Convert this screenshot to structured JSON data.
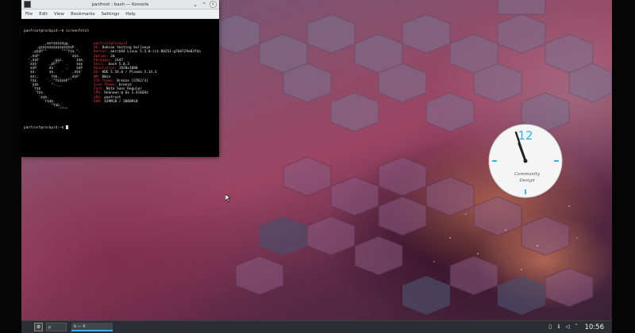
{
  "window": {
    "title": "panfrost : bash — Konsole",
    "menu": [
      "File",
      "Edit",
      "View",
      "Bookmarks",
      "Settings",
      "Help"
    ]
  },
  "terminal": {
    "command_line": "panfrost@rockpi4:~$ screenfetch",
    "logo_lines": [
      "         _,met$$$$$gg.",
      "      ,g$$$$$$$$$$$$$$$P.",
      "    ,g$$P\"\"       \"\"\"Y$$.\".",
      "   ,$$P'              `$$$.",
      "  ',$$P       ,ggs.     `$$b:",
      "  `d$$'     ,$P\"'   .    $$$",
      "   $$P      d$'     ,    $$P",
      "   $$:      $$.   -    ,d$$'",
      "   $$\\;      Y$b._   _,d$P'",
      "   Y$$.    `.`\"Y$$$$P\"'",
      "   `$$b      \"-.__",
      "    `Y$$",
      "     `Y$$.",
      "       `$$b.",
      "         `Y$$b.",
      "            `\"Y$b._",
      "                `\"\"\"\""
    ],
    "info": [
      {
        "k": "panfrost@rockpi4",
        "v": ""
      },
      {
        "k": "OS:",
        "v": " Debian testing bullseye"
      },
      {
        "k": "Kernel:",
        "v": " aarch64 Linux 5.3.0-rc1-00251-g7b0729e03f4a"
      },
      {
        "k": "Uptime:",
        "v": " 2m"
      },
      {
        "k": "Packages:",
        "v": " 1447"
      },
      {
        "k": "Shell:",
        "v": " bash 5.0.3"
      },
      {
        "k": "Resolution:",
        "v": " 1920x1080"
      },
      {
        "k": "DE:",
        "v": " KDE 5.54.0 / Plasma 5.14.3"
      },
      {
        "k": "WM:",
        "v": " KWin"
      },
      {
        "k": "GTK Theme:",
        "v": " Breeze [GTK2/3]"
      },
      {
        "k": "Icon Theme:",
        "v": " breeze"
      },
      {
        "k": "Font:",
        "v": " Noto Sans Regular"
      },
      {
        "k": "CPU:",
        "v": " Unknown @ 6x 1.416GHz"
      },
      {
        "k": "GPU:",
        "v": " panfrost"
      },
      {
        "k": "RAM:",
        "v": " 439MiB / 3806MiB"
      }
    ],
    "prompt": "panfrost@rockpi4:~$ "
  },
  "clock_widget": {
    "numeral": "12",
    "caption_line1": "Community",
    "caption_line2": "Design",
    "accent": "#3daee9"
  },
  "taskbar": {
    "pager_label": "p",
    "task_label": "b — K",
    "time": "10:56"
  }
}
